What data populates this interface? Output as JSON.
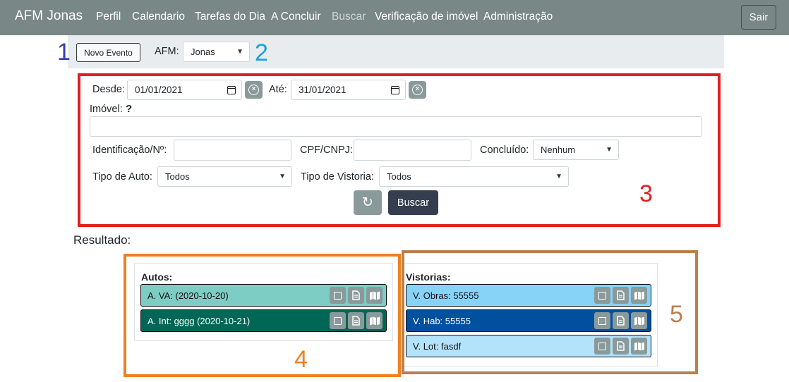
{
  "navbar": {
    "brand": "AFM Jonas",
    "links": [
      "Perfil",
      "Calendario",
      "Tarefas do Dia",
      "A Concluir",
      "Buscar",
      "Verificação de imóvel",
      "Administração"
    ],
    "logout_label": "Sair"
  },
  "toolbar": {
    "new_event_label": "Novo Evento",
    "afm_label": "AFM:",
    "afm_value": "Jonas"
  },
  "filter": {
    "desde_label": "Desde:",
    "desde_value": "01/01/2021",
    "ate_label": "Até:",
    "ate_value": "31/01/2021",
    "imovel_label": "Imóvel:",
    "imovel_help": "?",
    "imovel_value": "",
    "identificacao_label": "Identificação/Nº:",
    "identificacao_value": "",
    "cpf_label": "CPF/CNPJ:",
    "cpf_value": "",
    "concluido_label": "Concluído:",
    "concluido_value": "Nenhum",
    "tipo_auto_label": "Tipo de Auto:",
    "tipo_auto_value": "Todos",
    "tipo_vistoria_label": "Tipo de Vistoria:",
    "tipo_vistoria_value": "Todos",
    "search_label": "Buscar"
  },
  "results": {
    "label": "Resultado:",
    "autos": {
      "title": "Autos:",
      "items": [
        {
          "text": "A. VA: (2020-10-20)",
          "bg": "#7ecdc4",
          "color": "#111111"
        },
        {
          "text": "A. Int: gggg (2020-10-21)",
          "bg": "#006655",
          "color": "#ffffff"
        }
      ]
    },
    "vistorias": {
      "title": "Vistorias:",
      "items": [
        {
          "text": "V. Obras: 55555",
          "bg": "#87d3f8",
          "color": "#111111"
        },
        {
          "text": "V. Hab: 55555",
          "bg": "#0050a0",
          "color": "#ffffff"
        },
        {
          "text": "V. Lot: fasdf",
          "bg": "#b3e3fb",
          "color": "#111111"
        }
      ]
    }
  },
  "annotations": [
    {
      "label": "1",
      "color": "#3040b0"
    },
    {
      "label": "2",
      "color": "#18a0e0"
    },
    {
      "label": "3",
      "color": "#e02020"
    },
    {
      "label": "4",
      "color": "#f08020"
    },
    {
      "label": "5",
      "color": "#b88050"
    }
  ],
  "colors": {
    "navbar": "#7a8787",
    "strip": "#e9ecef",
    "primary_button": "#343e4e",
    "secondary_button": "#8a9a9a"
  },
  "icons": {
    "clear": "times-circle-icon",
    "calendar": "calendar-icon",
    "refresh": "refresh-icon",
    "checkbox": "square-icon",
    "document": "file-icon",
    "map": "map-icon"
  }
}
